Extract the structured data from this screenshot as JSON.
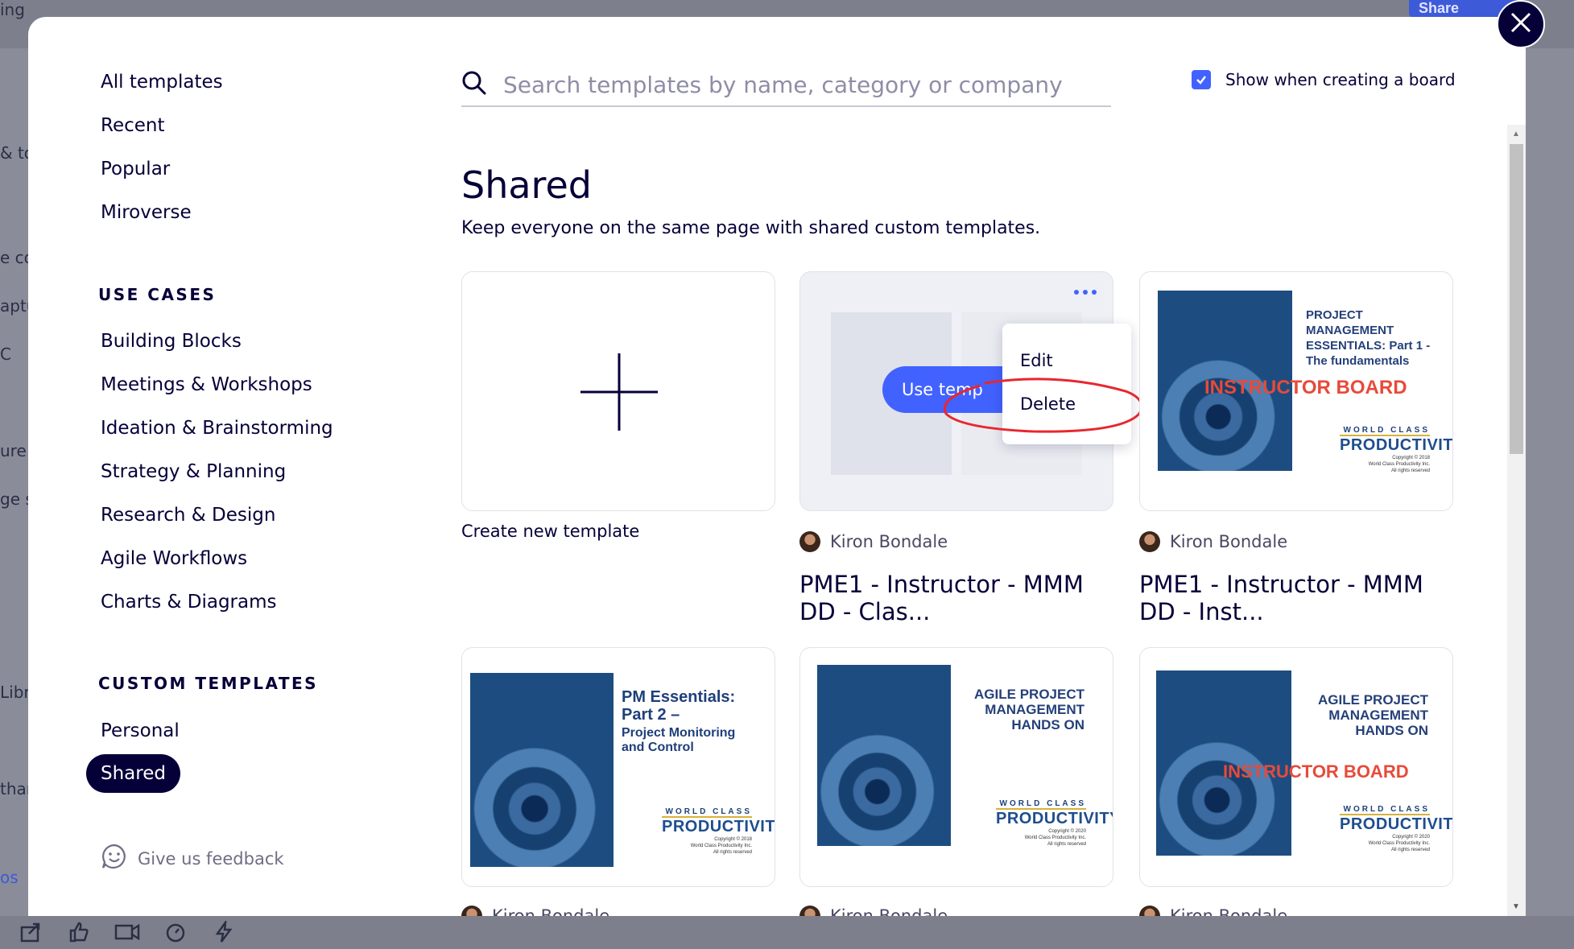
{
  "background": {
    "top_left_text": "ing",
    "share_label": "Share",
    "left_fragments": [
      "& to",
      "e co",
      "aptu",
      "C",
      "ure",
      "ge s",
      "Libra",
      "thar",
      "os"
    ]
  },
  "sidebar": {
    "nav": [
      {
        "label": "All templates"
      },
      {
        "label": "Recent"
      },
      {
        "label": "Popular"
      },
      {
        "label": "Miroverse"
      }
    ],
    "use_cases_heading": "USE CASES",
    "use_cases": [
      {
        "label": "Building Blocks"
      },
      {
        "label": "Meetings & Workshops"
      },
      {
        "label": "Ideation & Brainstorming"
      },
      {
        "label": "Strategy & Planning"
      },
      {
        "label": "Research & Design"
      },
      {
        "label": "Agile Workflows"
      },
      {
        "label": "Charts & Diagrams"
      }
    ],
    "custom_heading": "CUSTOM TEMPLATES",
    "custom": [
      {
        "label": "Personal"
      },
      {
        "label": "Shared",
        "active": true
      }
    ],
    "feedback_label": "Give us feedback"
  },
  "search": {
    "placeholder": "Search templates by name, category or company"
  },
  "show_when_creating": {
    "label": "Show when creating a board",
    "checked": true
  },
  "main": {
    "title": "Shared",
    "subtitle": "Keep everyone on the same page with shared custom templates."
  },
  "cards": {
    "create_label": "Create new template",
    "use_template_label": "Use temp",
    "menu": {
      "edit": "Edit",
      "delete": "Delete"
    },
    "items": [
      {
        "author": "Kiron Bondale",
        "title": "PME1 - Instructor - MMM DD - Clas..."
      },
      {
        "author": "Kiron Bondale",
        "title": "PME1 - Instructor - MMM DD - Inst...",
        "cover_title": "PROJECT MANAGEMENT ESSENTIALS: Part 1 - The fundamentals",
        "cover_overlay": "INSTRUCTOR BOARD"
      },
      {
        "author": "Kiron Bondale",
        "cover_title_1": "PM Essentials: Part 2 –",
        "cover_title_2": "Project Monitoring and Control"
      },
      {
        "author": "Kiron Bondale",
        "cover_title": "AGILE PROJECT MANAGEMENT HANDS ON"
      },
      {
        "author": "Kiron Bondale",
        "cover_title": "AGILE PROJECT MANAGEMENT HANDS ON",
        "cover_overlay": "INSTRUCTOR BOARD"
      }
    ],
    "brand": {
      "line1": "WORLD CLASS",
      "line2": "PRODUCTIVITY",
      "copyright_2018": "Copyright © 2018",
      "copyright_2020": "Copyright © 2020",
      "company": "World Class Productivity Inc.",
      "rights": "All rights reserved"
    }
  },
  "colors": {
    "primary": "#4262ff",
    "ink": "#050038",
    "annotation": "#e8262e"
  }
}
